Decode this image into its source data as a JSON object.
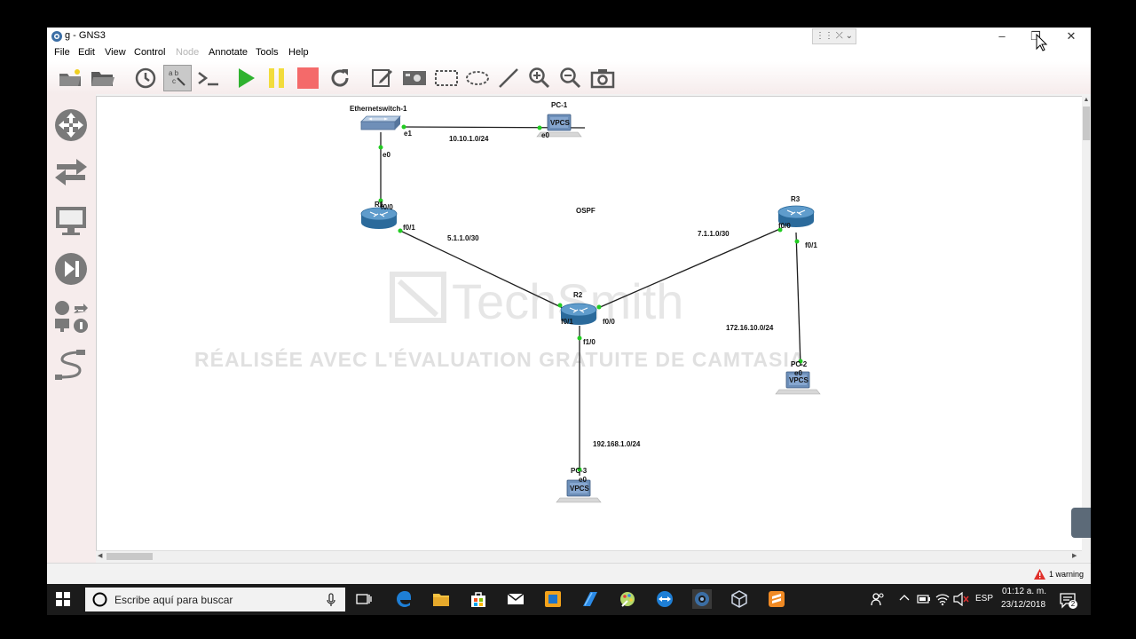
{
  "window": {
    "title": "g - GNS3",
    "minimize_icon": "–",
    "restore_icon": "❐",
    "close_icon": "✕"
  },
  "menu": [
    "File",
    "Edit",
    "View",
    "Control",
    "Node",
    "Annotate",
    "Tools",
    "Help"
  ],
  "menu_disabled": [
    "Node"
  ],
  "toolbar": {
    "buttons": [
      "open-folder",
      "open-project",
      "snapshot",
      "show-interface-labels",
      "console-all",
      "start-all",
      "suspend-all",
      "stop-all",
      "reload-all",
      "add-note",
      "insert-image",
      "draw-rectangle",
      "draw-ellipse",
      "draw-line",
      "zoom-in",
      "zoom-out",
      "screenshot"
    ]
  },
  "dock": {
    "buttons": [
      "routers",
      "switches",
      "end-devices",
      "security-devices",
      "all-devices",
      "add-link"
    ]
  },
  "topology": {
    "nodes": {
      "switch": "Ethernetswitch-1",
      "pc1": "PC-1",
      "r1": "R1",
      "r2": "R2",
      "r3": "R3",
      "pc2": "PC-2",
      "pc3": "PC-3"
    },
    "vpcs_label": "VPCS",
    "ports": {
      "sw_e1": "e1",
      "sw_e0": "e0",
      "pc1_e0": "e0",
      "r1_f00": "f0/0",
      "r1_f01": "f0/1",
      "r2_f01": "f0/1",
      "r2_f00": "f0/0",
      "r2_f10": "f1/0",
      "r3_f00": "f0/0",
      "r3_f01": "f0/1",
      "pc2_e0": "e0",
      "pc3_e0": "e0"
    },
    "networks": {
      "sw_pc1": "10.10.1.0/24",
      "r1_r2": "5.1.1.0/30",
      "r2_r3": "7.1.1.0/30",
      "r3_pc2": "172.16.10.0/24",
      "r2_pc3": "192.168.1.0/24"
    },
    "ospf": "OSPF",
    "link_color": "#1e1e1e",
    "port_up_color": "#22cc22"
  },
  "watermark": {
    "brand": "TechSmith",
    "text": "RÉALISÉE AVEC L'ÉVALUATION GRATUITE DE CAMTASIA"
  },
  "status": {
    "warning": "1 warning"
  },
  "taskbar": {
    "search_placeholder": "Escribe aquí para buscar",
    "language": "ESP",
    "time": "01:12 a. m.",
    "date": "23/12/2018",
    "notifications": "2",
    "apps": [
      "task-view",
      "edge",
      "file-explorer",
      "store",
      "mail",
      "app-orange",
      "vs-code",
      "paint",
      "teamviewer",
      "gns3",
      "virtualbox",
      "sublime"
    ]
  }
}
